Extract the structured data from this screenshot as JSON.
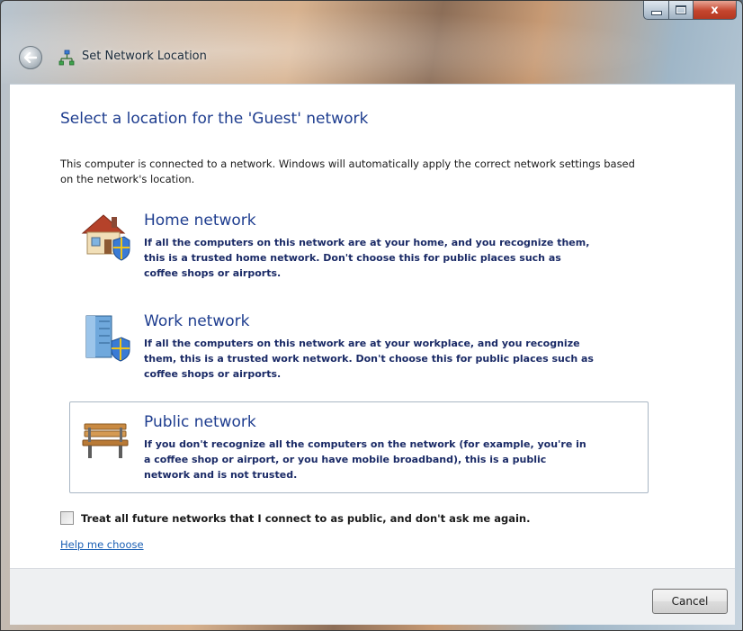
{
  "window": {
    "title": "Set Network Location",
    "caption_buttons": {
      "close": "x"
    }
  },
  "content": {
    "heading": "Select a location for the 'Guest' network",
    "intro": "This computer is connected to a network. Windows will automatically apply the correct network settings based on the network's location.",
    "options": [
      {
        "title": "Home network",
        "desc_lines": [
          "If all the computers on this network are at your home, and you recognize them,",
          "this is a trusted home network.  Don't choose this for public places such as",
          "coffee shops or airports."
        ],
        "icon": "house-icon"
      },
      {
        "title": "Work network",
        "desc_lines": [
          "If all the computers on this network are at your workplace, and you recognize",
          "them, this is a trusted work network.  Don't choose this for public places such as",
          "coffee shops or airports."
        ],
        "icon": "office-building-icon"
      },
      {
        "title": "Public network",
        "desc_lines": [
          "If you don't recognize all the computers on the network (for example, you're in",
          "a coffee shop or airport, or you have mobile broadband), this is a public",
          "network and is not trusted."
        ],
        "icon": "park-bench-icon",
        "selected": true
      }
    ],
    "checkbox_label": "Treat all future networks that I connect to as public, and don't ask me again.",
    "checkbox_checked": false,
    "help_link": "Help me choose"
  },
  "footer": {
    "cancel_label": "Cancel"
  }
}
